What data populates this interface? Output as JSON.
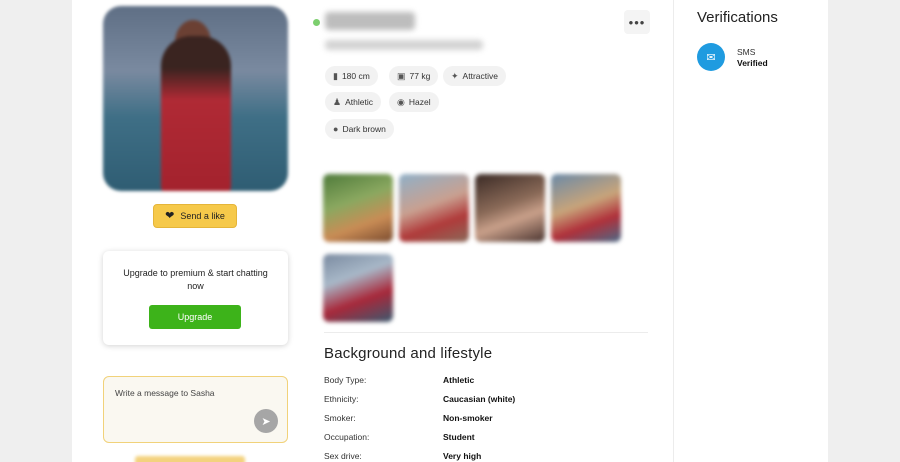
{
  "profile": {
    "actions": {
      "send_like": "Send a like"
    },
    "more_icon": "more-dots-icon",
    "attributes": [
      {
        "icon": "ruler-icon",
        "label": "180 cm"
      },
      {
        "icon": "scale-icon",
        "label": "77 kg"
      },
      {
        "icon": "sparkle-icon",
        "label": "Attractive"
      },
      {
        "icon": "body-icon",
        "label": "Athletic"
      },
      {
        "icon": "eye-icon",
        "label": "Hazel"
      },
      {
        "icon": "hair-icon",
        "label": "Dark brown"
      }
    ]
  },
  "upgrade": {
    "message": "Upgrade to premium & start chatting now",
    "button": "Upgrade"
  },
  "message_box": {
    "placeholder": "Write a message to Sasha",
    "send_icon": "send-icon"
  },
  "background": {
    "title": "Background and lifestyle",
    "rows": [
      {
        "key": "Body Type:",
        "value": "Athletic"
      },
      {
        "key": "Ethnicity:",
        "value": "Caucasian (white)"
      },
      {
        "key": "Smoker:",
        "value": "Non-smoker"
      },
      {
        "key": "Occupation:",
        "value": "Student"
      },
      {
        "key": "Sex drive:",
        "value": "Very high"
      }
    ]
  },
  "verifications": {
    "title": "Verifications",
    "items": [
      {
        "icon": "sms-icon",
        "label": "SMS",
        "status": "Verified"
      }
    ]
  },
  "colors": {
    "accent_like": "#f6c94a",
    "upgrade_green": "#3db31a",
    "online_green": "#7ccf6e",
    "sms_blue": "#1f9be0"
  }
}
